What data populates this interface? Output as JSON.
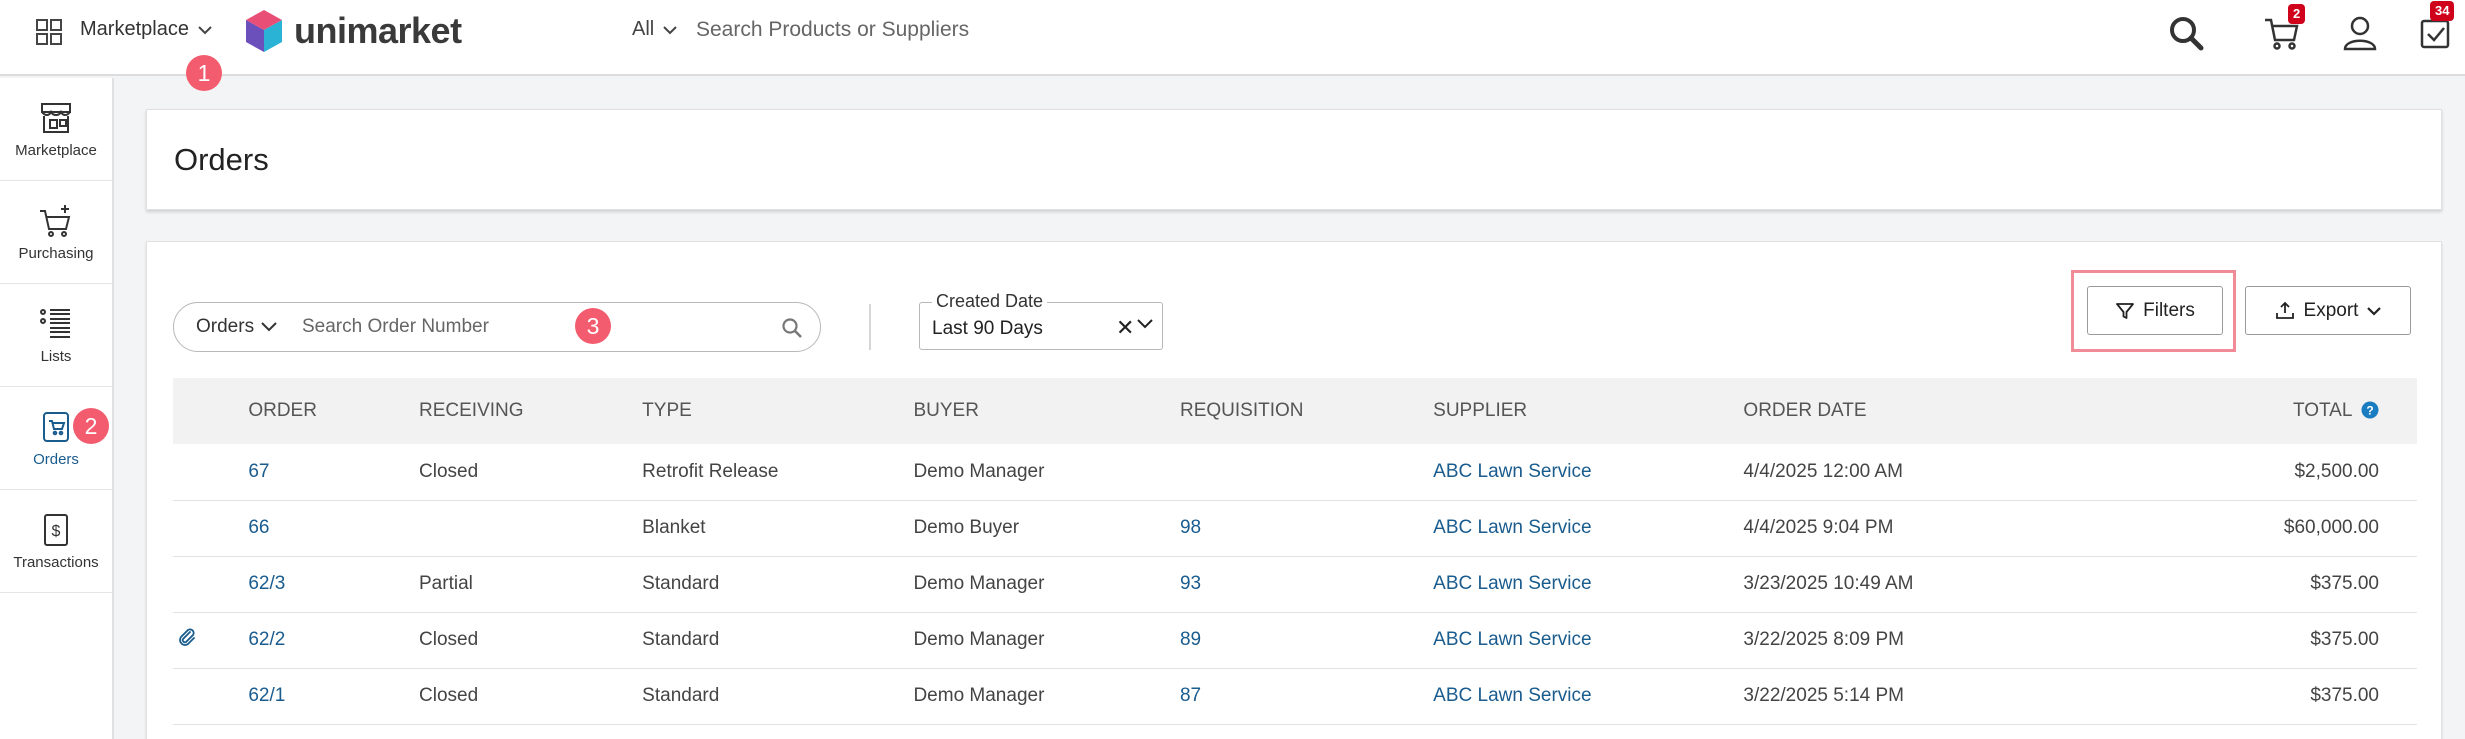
{
  "topbar": {
    "app_switcher_label": "Marketplace",
    "logo_text": "unimarket",
    "search_scope": "All",
    "search_placeholder": "Search Products or Suppliers",
    "cart_count": "2",
    "tasks_count": "34"
  },
  "markers": [
    "1",
    "2",
    "3"
  ],
  "sidebar": {
    "items": [
      {
        "label": "Marketplace",
        "icon": "storefront-icon",
        "active": false
      },
      {
        "label": "Purchasing",
        "icon": "cart-plus-icon",
        "active": false
      },
      {
        "label": "Lists",
        "icon": "list-icon",
        "active": false
      },
      {
        "label": "Orders",
        "icon": "orders-icon",
        "active": true
      },
      {
        "label": "Transactions",
        "icon": "transactions-icon",
        "active": false
      }
    ]
  },
  "page": {
    "title": "Orders"
  },
  "search": {
    "scope": "Orders",
    "placeholder": "Search Order Number"
  },
  "date_filter": {
    "label": "Created Date",
    "value": "Last 90 Days"
  },
  "buttons": {
    "filters": "Filters",
    "export": "Export"
  },
  "table": {
    "columns": [
      "ORDER",
      "RECEIVING",
      "TYPE",
      "BUYER",
      "REQUISITION",
      "SUPPLIER",
      "ORDER DATE",
      "TOTAL"
    ],
    "rows": [
      {
        "attachment": false,
        "order": "67",
        "receiving": "Closed",
        "type": "Retrofit Release",
        "buyer": "Demo Manager",
        "requisition": "",
        "supplier": "ABC Lawn Service",
        "order_date": "4/4/2025 12:00 AM",
        "total": "$2,500.00"
      },
      {
        "attachment": false,
        "order": "66",
        "receiving": "",
        "type": "Blanket",
        "buyer": "Demo Buyer",
        "requisition": "98",
        "supplier": "ABC Lawn Service",
        "order_date": "4/4/2025 9:04 PM",
        "total": "$60,000.00"
      },
      {
        "attachment": false,
        "order": "62/3",
        "receiving": "Partial",
        "type": "Standard",
        "buyer": "Demo Manager",
        "requisition": "93",
        "supplier": "ABC Lawn Service",
        "order_date": "3/23/2025 10:49 AM",
        "total": "$375.00"
      },
      {
        "attachment": true,
        "order": "62/2",
        "receiving": "Closed",
        "type": "Standard",
        "buyer": "Demo Manager",
        "requisition": "89",
        "supplier": "ABC Lawn Service",
        "order_date": "3/22/2025 8:09 PM",
        "total": "$375.00"
      },
      {
        "attachment": false,
        "order": "62/1",
        "receiving": "Closed",
        "type": "Standard",
        "buyer": "Demo Manager",
        "requisition": "87",
        "supplier": "ABC Lawn Service",
        "order_date": "3/22/2025 5:14 PM",
        "total": "$375.00"
      }
    ]
  },
  "colors": {
    "link": "#1a5c8e",
    "badge": "#d0021b",
    "marker": "#f25c6e",
    "highlight": "#f08b97"
  }
}
